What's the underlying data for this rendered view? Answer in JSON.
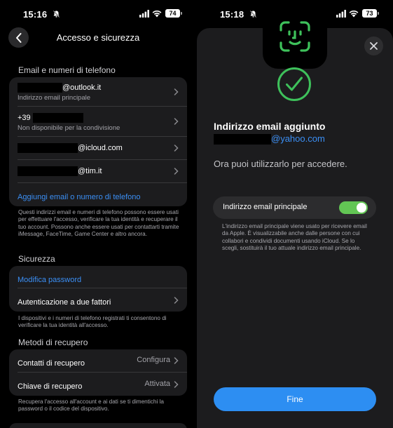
{
  "left": {
    "status": {
      "time": "15:16",
      "battery": "74"
    },
    "nav": {
      "title": "Accesso e sicurezza"
    },
    "email_section": {
      "title": "Email e numeri di telefono",
      "items": [
        {
          "value": "@outlook.it",
          "subtitle": "Indirizzo email principale"
        },
        {
          "value": "+39",
          "subtitle": "Non disponibile per la condivisione"
        },
        {
          "value": "@icloud.com",
          "subtitle": ""
        },
        {
          "value": "@tim.it",
          "subtitle": ""
        }
      ],
      "add_label": "Aggiungi email o numero di telefono",
      "footnote": "Questi indirizzi email e numeri di telefono possono essere usati per effettuare l'accesso, verificare la tua identità e recuperare il tuo account. Possono anche essere usati per contattarti tramite iMessage, FaceTime, Game Center e altro ancora."
    },
    "security_section": {
      "title": "Sicurezza",
      "change_password": "Modifica password",
      "two_factor": "Autenticazione a due fattori",
      "footnote": "I dispositivi e i numeri di telefono registrati ti consentono di verificare la tua identità all'accesso."
    },
    "recovery_section": {
      "title": "Metodi di recupero",
      "contacts_label": "Contatti di recupero",
      "contacts_value": "Configura",
      "key_label": "Chiave di recupero",
      "key_value": "Attivata",
      "footnote": "Recupera l'accesso all'account e ai dati se ti dimentichi la password o il codice del dispositivo."
    }
  },
  "right": {
    "status": {
      "time": "15:18",
      "battery": "73"
    },
    "title": "Indirizzo email aggiunto",
    "email": "@yahoo.com",
    "description": "Ora puoi utilizzarlo per accedere.",
    "toggle_label": "Indirizzo email principale",
    "toggle_on": true,
    "footnote": "L'indirizzo email principale viene usato per ricevere email da Apple. È visualizzabile anche dalle persone con cui collabori e condividi documenti usando iCloud. Se lo scegli, sostituirà il tuo attuale indirizzo email principale.",
    "done_label": "Fine"
  },
  "colors": {
    "link": "#3b8ff5",
    "toggle_on": "#62c554",
    "done_button": "#2d8ef2",
    "success": "#3ec15b"
  }
}
